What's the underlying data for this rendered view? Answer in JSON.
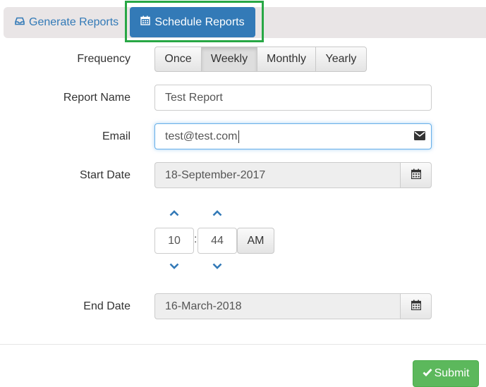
{
  "tabs": {
    "generate": {
      "label": "Generate Reports",
      "icon": "inbox-icon"
    },
    "schedule": {
      "label": "Schedule Reports",
      "icon": "calendar-icon"
    }
  },
  "form": {
    "frequency": {
      "label": "Frequency",
      "options": [
        "Once",
        "Weekly",
        "Monthly",
        "Yearly"
      ],
      "selected": "Weekly"
    },
    "report_name": {
      "label": "Report Name",
      "value": "Test Report"
    },
    "email": {
      "label": "Email",
      "value": "test@test.com",
      "icon": "envelope-icon"
    },
    "start_date": {
      "label": "Start Date",
      "value": "18-September-2017",
      "icon": "calendar-icon"
    },
    "time": {
      "hour": "10",
      "separator": ":",
      "minute": "44",
      "meridian": "AM"
    },
    "end_date": {
      "label": "End Date",
      "value": "16-March-2018",
      "icon": "calendar-icon"
    }
  },
  "submit": {
    "label": "Submit",
    "icon": "check-icon"
  },
  "colors": {
    "primary": "#337ab7",
    "highlight_outline": "#28a745",
    "success": "#5cb85c",
    "tab_bar": "#e9e5e6"
  }
}
